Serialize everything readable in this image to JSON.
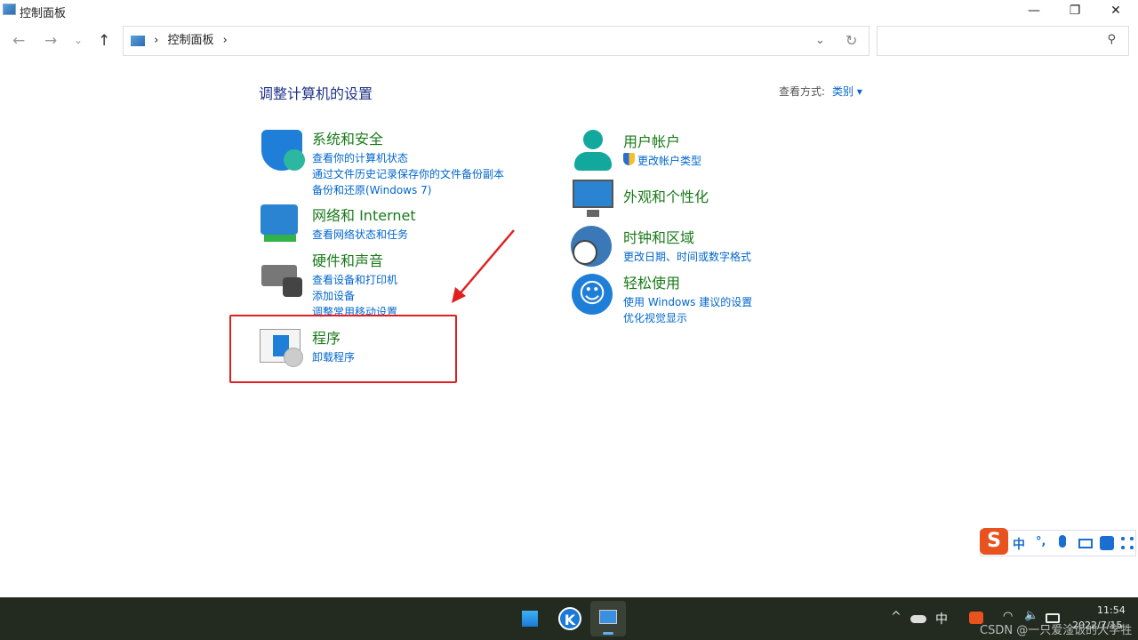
{
  "window": {
    "title": "控制面板",
    "minimize": "—",
    "maximize": "❐",
    "close": "✕"
  },
  "nav": {
    "back": "←",
    "forward": "→",
    "recent": "⌄",
    "up": "↑"
  },
  "address": {
    "sep": "›",
    "path": "控制面板",
    "dropdown": "⌄",
    "refresh": "↻"
  },
  "search": {
    "placeholder": "",
    "icon": "search-icon"
  },
  "main": {
    "heading": "调整计算机的设置",
    "view_label": "查看方式:",
    "view_value": "类别 ▾",
    "categories": [
      {
        "title": "系统和安全",
        "links": [
          "查看你的计算机状态",
          "通过文件历史记录保存你的文件备份副本",
          "备份和还原(Windows 7)"
        ]
      },
      {
        "title": "网络和 Internet",
        "links": [
          "查看网络状态和任务"
        ]
      },
      {
        "title": "硬件和声音",
        "links": [
          "查看设备和打印机",
          "添加设备",
          "调整常用移动设置"
        ]
      },
      {
        "title": "程序",
        "links": [
          "卸载程序"
        ]
      },
      {
        "title": "用户帐户",
        "links": [
          "更改帐户类型"
        ]
      },
      {
        "title": "外观和个性化",
        "links": []
      },
      {
        "title": "时钟和区域",
        "links": [
          "更改日期、时间或数字格式"
        ]
      },
      {
        "title": "轻松使用",
        "links": [
          "使用 Windows 建议的设置",
          "优化视觉显示"
        ]
      }
    ]
  },
  "ime": {
    "logo": "S",
    "mode": "中",
    "punct": "°,",
    "items": [
      "mic-icon",
      "keyboard-icon",
      "skin-icon",
      "toolbox-icon"
    ]
  },
  "tray": {
    "chevron": "^",
    "ime": "中",
    "time": "11:54",
    "date": "2022/7/15"
  },
  "watermark": "CSDN @一只爱淦饭的大学牲",
  "colors": {
    "highlight_box": "#e02020",
    "taskbar": "#232a1f",
    "link": "#0066cc",
    "category": "#1a7a1a"
  }
}
